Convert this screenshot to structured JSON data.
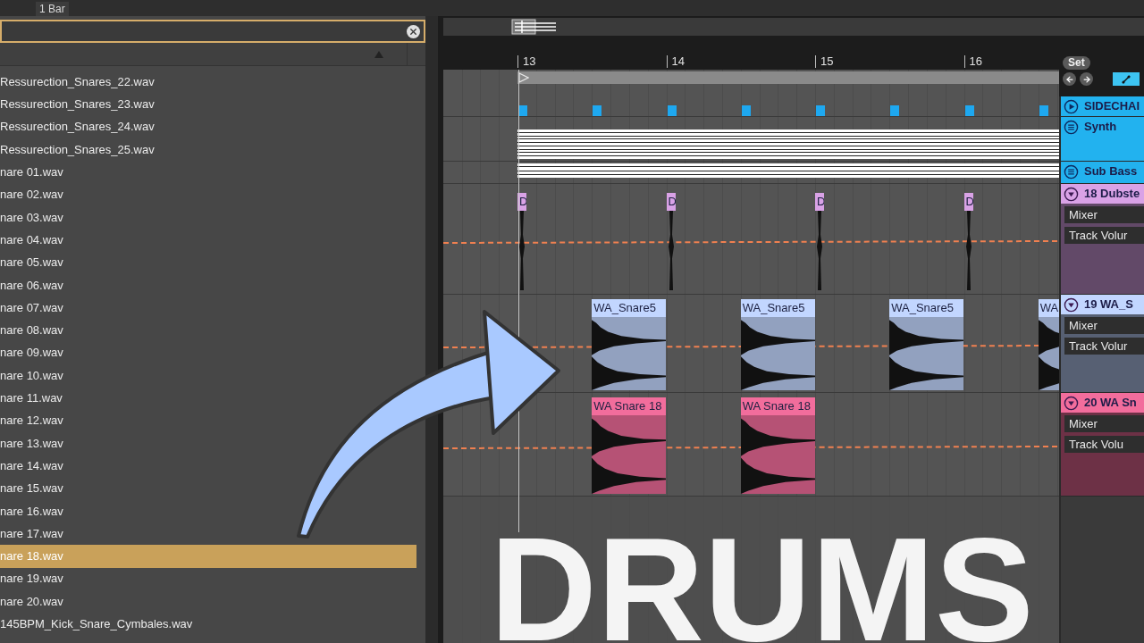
{
  "toolbar": {
    "quantize": "1 Bar"
  },
  "files": [
    {
      "name": "Ressurection_Snares_22.wav",
      "selected": false
    },
    {
      "name": "Ressurection_Snares_23.wav",
      "selected": false
    },
    {
      "name": "Ressurection_Snares_24.wav",
      "selected": false
    },
    {
      "name": "Ressurection_Snares_25.wav",
      "selected": false
    },
    {
      "name": "nare 01.wav",
      "selected": false
    },
    {
      "name": "nare 02.wav",
      "selected": false
    },
    {
      "name": "nare 03.wav",
      "selected": false
    },
    {
      "name": "nare 04.wav",
      "selected": false
    },
    {
      "name": "nare 05.wav",
      "selected": false
    },
    {
      "name": "nare 06.wav",
      "selected": false
    },
    {
      "name": "nare 07.wav",
      "selected": false
    },
    {
      "name": "nare 08.wav",
      "selected": false
    },
    {
      "name": "nare 09.wav",
      "selected": false
    },
    {
      "name": "nare 10.wav",
      "selected": false
    },
    {
      "name": "nare 11.wav",
      "selected": false
    },
    {
      "name": "nare 12.wav",
      "selected": false
    },
    {
      "name": "nare 13.wav",
      "selected": false
    },
    {
      "name": "nare 14.wav",
      "selected": false
    },
    {
      "name": "nare 15.wav",
      "selected": false
    },
    {
      "name": "nare 16.wav",
      "selected": false
    },
    {
      "name": "nare 17.wav",
      "selected": false
    },
    {
      "name": "nare 18.wav",
      "selected": true
    },
    {
      "name": "nare 19.wav",
      "selected": false
    },
    {
      "name": "nare 20.wav",
      "selected": false
    },
    {
      "name": "145BPM_Kick_Snare_Cymbales.wav",
      "selected": false
    }
  ],
  "arrangement": {
    "ruler": [
      "13",
      "14",
      "15",
      "16"
    ],
    "set_button": "Set",
    "tracks": [
      {
        "name": "SIDECHAI",
        "kind": "trigger",
        "color": "#22b2ef",
        "expanded": false
      },
      {
        "name": "Synth",
        "kind": "midi",
        "color": "#22b2ef",
        "expanded": false
      },
      {
        "name": "Sub Bass",
        "kind": "midi",
        "color": "#22b2ef",
        "expanded": false
      },
      {
        "name": "18 Dubste",
        "kind": "audio",
        "color": "#d9a2e6",
        "expanded": true,
        "device": "Mixer",
        "parameter": "Track Volur",
        "clips": [
          {
            "label": "D"
          },
          {
            "label": "D"
          },
          {
            "label": "D"
          },
          {
            "label": "D"
          }
        ]
      },
      {
        "name": "19 WA_S",
        "kind": "audio",
        "color": "#c2d6ff",
        "expanded": true,
        "device": "Mixer",
        "parameter": "Track Volur",
        "clips": [
          {
            "label": "WA_Snare5"
          },
          {
            "label": "WA_Snare5"
          },
          {
            "label": "WA_Snare5"
          },
          {
            "label": "WA"
          }
        ]
      },
      {
        "name": "20 WA Sn",
        "kind": "audio",
        "color": "#f26d9c",
        "expanded": true,
        "device": "Mixer",
        "parameter": "Track Volu",
        "clips": [
          {
            "label": "WA Snare 18"
          },
          {
            "label": "WA Snare 18"
          }
        ]
      }
    ]
  },
  "overlay": {
    "title": "DRUMS"
  }
}
